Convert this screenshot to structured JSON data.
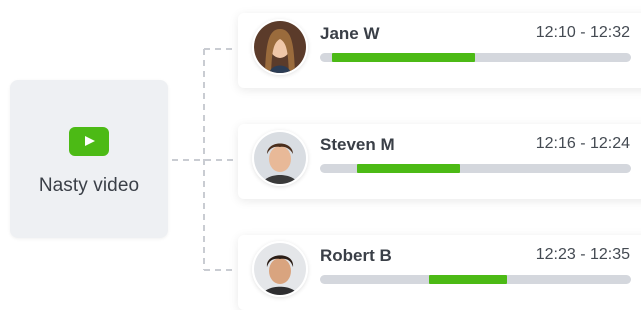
{
  "video": {
    "title": "Nasty video",
    "icon": "play-icon",
    "icon_color": "#4cba15"
  },
  "accent_color": "#4cba15",
  "viewers": [
    {
      "name": "Jane W",
      "time": "12:10 - 12:32",
      "watched_start": 0.04,
      "watched_end": 0.5
    },
    {
      "name": "Steven M",
      "time": "12:16 - 12:24",
      "watched_start": 0.12,
      "watched_end": 0.45
    },
    {
      "name": "Robert B",
      "time": "12:23 - 12:35",
      "watched_start": 0.35,
      "watched_end": 0.6
    }
  ]
}
